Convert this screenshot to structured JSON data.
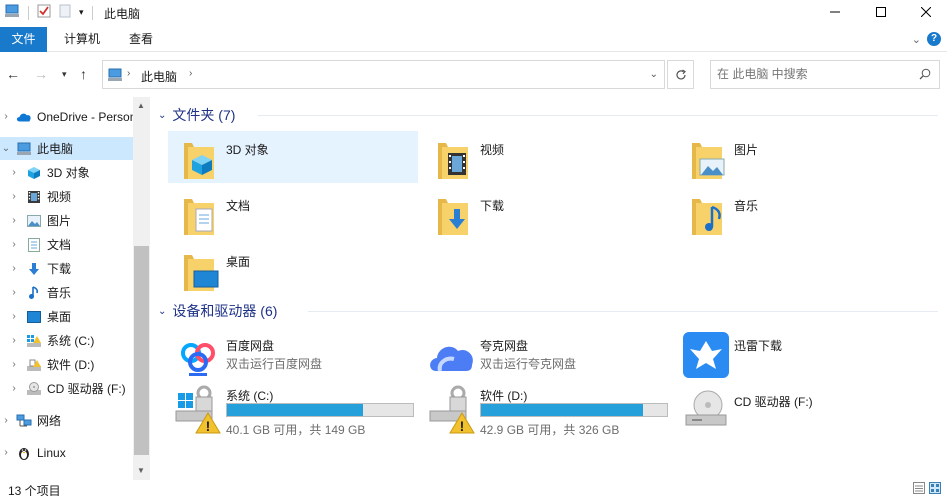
{
  "window": {
    "title": "此电脑"
  },
  "ribbon": {
    "tabs": [
      "文件",
      "计算机",
      "查看"
    ]
  },
  "address": {
    "crumbs": [
      "此电脑"
    ]
  },
  "search": {
    "placeholder": "在 此电脑 中搜索"
  },
  "sidebar": {
    "items": [
      {
        "label": "OneDrive - Personal",
        "icon": "onedrive-cloud-icon"
      },
      {
        "label": "此电脑",
        "icon": "computer-icon"
      },
      {
        "label": "3D 对象",
        "icon": "3d-cube-icon"
      },
      {
        "label": "视频",
        "icon": "film-icon"
      },
      {
        "label": "图片",
        "icon": "picture-icon"
      },
      {
        "label": "文档",
        "icon": "document-icon"
      },
      {
        "label": "下载",
        "icon": "download-arrow-icon"
      },
      {
        "label": "音乐",
        "icon": "music-note-icon"
      },
      {
        "label": "桌面",
        "icon": "desktop-icon"
      },
      {
        "label": "系统 (C:)",
        "icon": "windows-drive-icon"
      },
      {
        "label": "软件 (D:)",
        "icon": "drive-icon"
      },
      {
        "label": "CD 驱动器 (F:)",
        "icon": "cd-drive-icon"
      },
      {
        "label": "网络",
        "icon": "network-icon"
      },
      {
        "label": "Linux",
        "icon": "linux-penguin-icon"
      }
    ]
  },
  "folders": {
    "heading": "文件夹 (7)",
    "items": [
      {
        "label": "3D 对象",
        "icon": "3d-objects-folder-icon"
      },
      {
        "label": "视频",
        "icon": "videos-folder-icon"
      },
      {
        "label": "图片",
        "icon": "pictures-folder-icon"
      },
      {
        "label": "文档",
        "icon": "documents-folder-icon"
      },
      {
        "label": "下载",
        "icon": "downloads-folder-icon"
      },
      {
        "label": "音乐",
        "icon": "music-folder-icon"
      },
      {
        "label": "桌面",
        "icon": "desktop-folder-icon"
      }
    ]
  },
  "devices": {
    "heading": "设备和驱动器 (6)",
    "apps": [
      {
        "label": "百度网盘",
        "sub": "双击运行百度网盘",
        "icon": "baidu-netdisk-icon"
      },
      {
        "label": "夸克网盘",
        "sub": "双击运行夸克网盘",
        "icon": "quark-netdisk-icon"
      },
      {
        "label": "迅雷下载",
        "sub": "",
        "icon": "xunlei-icon"
      }
    ],
    "drives": [
      {
        "label": "系统 (C:)",
        "free": "40.1 GB 可用，共 149 GB",
        "used_fraction": 0.73,
        "icon": "system-drive-warning-icon"
      },
      {
        "label": "软件 (D:)",
        "free": "42.9 GB 可用，共 326 GB",
        "used_fraction": 0.87,
        "icon": "drive-warning-icon"
      },
      {
        "label": "CD 驱动器 (F:)",
        "icon": "cd-drive-icon"
      }
    ]
  },
  "status": {
    "count": "13 个项目"
  },
  "colors": {
    "accent": "#1979ca",
    "selection": "#cce8ff",
    "drive_bar": "#26a0da",
    "group_heading": "#1e3287"
  }
}
